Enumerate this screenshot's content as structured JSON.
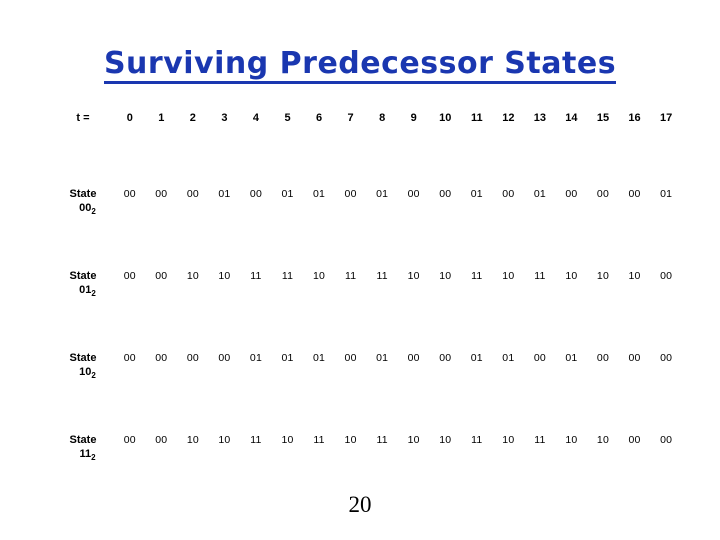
{
  "slide": {
    "title": "Surviving Predecessor States",
    "title_color": "#1a37b0",
    "page_number": "20"
  },
  "table": {
    "time_label": "t =",
    "columns": [
      "0",
      "1",
      "2",
      "3",
      "4",
      "5",
      "6",
      "7",
      "8",
      "9",
      "10",
      "11",
      "12",
      "13",
      "14",
      "15",
      "16",
      "17"
    ],
    "rows": [
      {
        "label_line1": "State",
        "label_line2": "00",
        "label_sub": "2",
        "values": [
          "00",
          "00",
          "00",
          "01",
          "00",
          "01",
          "01",
          "00",
          "01",
          "00",
          "00",
          "01",
          "00",
          "01",
          "00",
          "00",
          "00",
          "01"
        ]
      },
      {
        "label_line1": "State",
        "label_line2": "01",
        "label_sub": "2",
        "values": [
          "00",
          "00",
          "10",
          "10",
          "11",
          "11",
          "10",
          "11",
          "11",
          "10",
          "10",
          "11",
          "10",
          "11",
          "10",
          "10",
          "10",
          "00"
        ]
      },
      {
        "label_line1": "State",
        "label_line2": "10",
        "label_sub": "2",
        "values": [
          "00",
          "00",
          "00",
          "00",
          "01",
          "01",
          "01",
          "00",
          "01",
          "00",
          "00",
          "01",
          "01",
          "00",
          "01",
          "00",
          "00",
          "00"
        ]
      },
      {
        "label_line1": "State",
        "label_line2": "11",
        "label_sub": "2",
        "values": [
          "00",
          "00",
          "10",
          "10",
          "11",
          "10",
          "11",
          "10",
          "11",
          "10",
          "10",
          "11",
          "10",
          "11",
          "10",
          "10",
          "00",
          "00"
        ]
      }
    ]
  }
}
